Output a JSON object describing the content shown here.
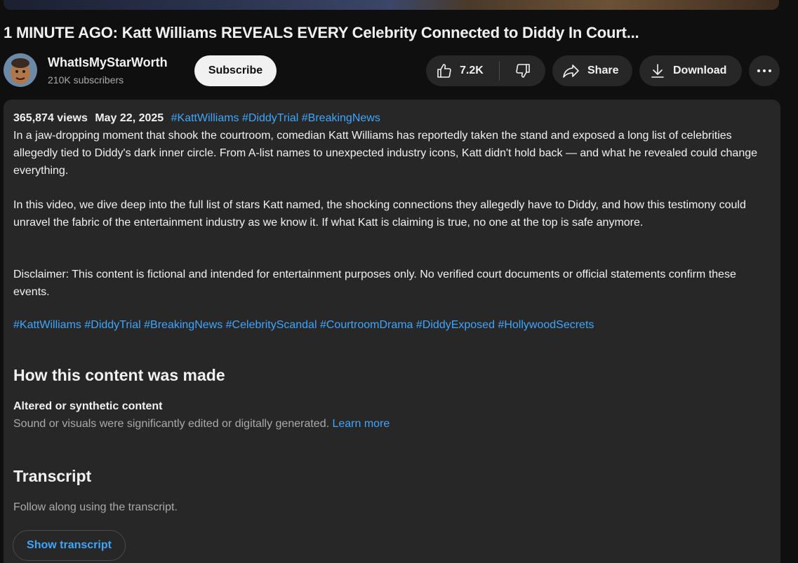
{
  "video": {
    "title": "1 MINUTE AGO: Katt Williams REVEALS EVERY Celebrity Connected to Diddy In Court..."
  },
  "channel": {
    "name": "WhatIsMyStarWorth",
    "subscribers": "210K subscribers",
    "subscribe_label": "Subscribe",
    "avatar_icon": "channel-avatar"
  },
  "actions": {
    "likes": "7.2K",
    "share_label": "Share",
    "download_label": "Download",
    "like_icon": "thumbs-up-icon",
    "dislike_icon": "thumbs-down-icon",
    "share_icon": "share-arrow-icon",
    "download_icon": "download-icon",
    "more_icon": "more-horizontal-icon"
  },
  "description": {
    "views": "365,874 views",
    "date": "May 22, 2025",
    "top_tags": [
      "#KattWilliams",
      "#DiddyTrial",
      "#BreakingNews"
    ],
    "paragraph1": "In a jaw-dropping moment that shook the courtroom, comedian Katt Williams has reportedly taken the stand and exposed a long list of celebrities allegedly tied to Diddy's dark inner circle. From A-list names to unexpected industry icons, Katt didn't hold back — and what he revealed could change everything.",
    "paragraph2": "In this video, we dive deep into the full list of stars Katt named, the shocking connections they allegedly have to Diddy, and how this testimony could unravel the fabric of the entertainment industry as we know it. If what Katt is claiming is true, no one at the top is safe anymore.",
    "paragraph3": "Disclaimer: This content is fictional and intended for entertainment purposes only. No verified court documents or official statements confirm these events.",
    "hashtags": [
      "#KattWilliams",
      "#DiddyTrial",
      "#BreakingNews",
      "#CelebrityScandal",
      "#CourtroomDrama",
      "#DiddyExposed",
      "#HollywoodSecrets"
    ]
  },
  "how_made": {
    "heading": "How this content was made",
    "label": "Altered or synthetic content",
    "text": "Sound or visuals were significantly edited or digitally generated.",
    "learn_more": "Learn more"
  },
  "transcript": {
    "heading": "Transcript",
    "text": "Follow along using the transcript.",
    "button_label": "Show transcript"
  },
  "colors": {
    "background": "#0f0f0f",
    "panel": "#272727",
    "link": "#3ea6ff",
    "text": "#f1f1f1",
    "muted": "#aaaaaa"
  }
}
